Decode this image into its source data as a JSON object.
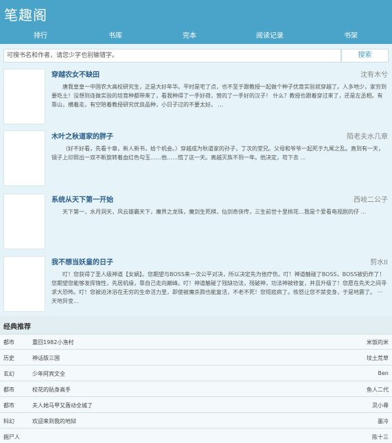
{
  "header": {
    "logo": "笔趣阁",
    "nav": [
      "排行",
      "书库",
      "完本",
      "阅读记录",
      "书架"
    ]
  },
  "search": {
    "placeholder": "可搜书名和作者，请您少字也别输错字。",
    "button_label": "搜索"
  },
  "books": [
    {
      "title": "穿越农女不缺田",
      "author": "沈有木兮",
      "desc": "唐我皇皇一中国农大高校研究生，正是大好年华。平时是宅了点，也不至于跟教授一起做个种子优育实验就穿越了。人多地少，家穷到要吃土！没想到连做实验的培育种都带来了，看我种得了一手好荷，营的了一手好的汉子！ 什么？教授也跟着穿过来了，还是左丞相。有靠山，横着走，有空陪着教授研究优良品种，小日子过的不要太好。 ..."
    },
    {
      "title": "木叶之秋道家的胖子",
      "author": "陌老夫水几章",
      "desc": "（好不好看，先看十章，新人新书，给个机会。）穿越成为秋道家的孙子，丁次的堂兄。父母和爷爷一起死于九尾之乱。直到有一天，镜子上印照出一双不断旋转着血红色勾玉……他……慌了这一天。离越灭族不到一年。他决定，苟下去 ..."
    },
    {
      "title": "系统从天下第一开始",
      "author": "西岐二公子",
      "desc": "天下第一，水月洞天，风云雄霸天下，魔界之龙珠，魔剑生死棋，仙剑奇侠传，三生前世十里桃花…我是个爱看电视剧的仔 ..."
    },
    {
      "title": "我不想当妖皇的日子",
      "author": "剪水II",
      "desc": "叮！您获得了圣人级神道【女娲】。您期望与BOSS来一次公平对决，所以决定先为他疗伤。叮！神道触碰了BOSS，BOSS被奶炸了！您期望您能够发挥惰性，先居机缘，靠自己走向巅峰。叮！神道触碰了残缺功法，残破神，功法神被修复，并且升级了！您愿在先天之间寻求大恐怖。叮！您被迫沐浴在无穷的生命活力里，即使被魔杀戮也能复活，不老不死！您彻底疯了。恢怒让您不禁变身，于是地震了。 ··· 天地异变..."
    }
  ],
  "recommend": {
    "title": "经典推荐",
    "items": [
      {
        "category": "都市",
        "name": "重回1982小渔村",
        "author": "米饭的米"
      },
      {
        "category": "历史",
        "name": "神话版三国",
        "author": "坟土荒草"
      },
      {
        "category": "玄幻",
        "name": "少年阿宾文全",
        "author": "Ben"
      },
      {
        "category": "都市",
        "name": "校花的贴身高手",
        "author": "鱼人二代"
      },
      {
        "category": "都市",
        "name": "夫人她马甲又轰动全城了",
        "author": "灵小尋"
      },
      {
        "category": "科幻",
        "name": "欢迎来到我的地狱",
        "author": "墨冷"
      },
      {
        "category": "掘尸人",
        "name": "",
        "author": "陈十三"
      }
    ]
  }
}
